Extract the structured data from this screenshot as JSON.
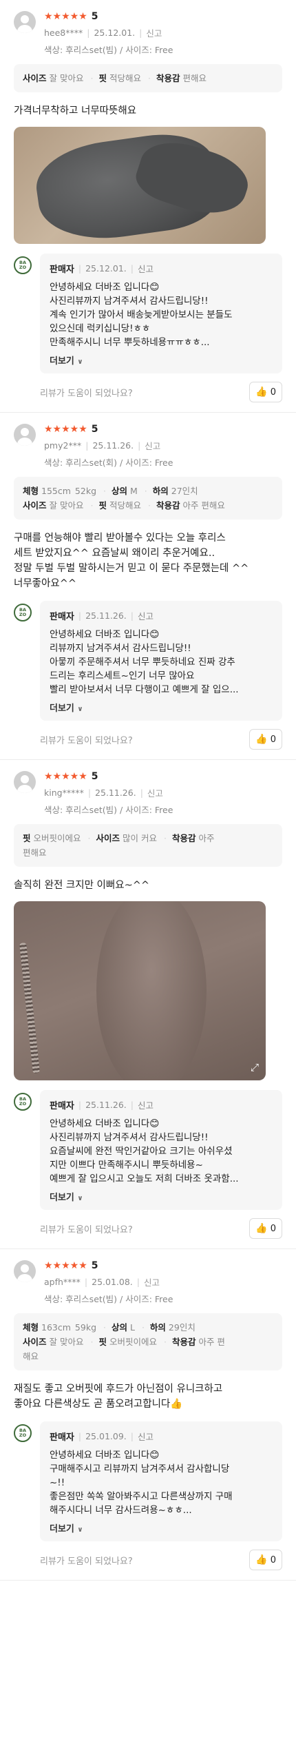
{
  "common": {
    "stars": "★★★★★",
    "report_label": "신고",
    "helpful_question": "리뷰가 도움이 되었나요?",
    "more_label": "더보기",
    "seller_name": "판매자",
    "logo_text": "BA ZO",
    "colors": {
      "star": "#f25a2f",
      "like": "#e0312b",
      "seller_logo": "#3f6b3a"
    }
  },
  "reviews": [
    {
      "score": "5",
      "user": "hee8****",
      "date": "25.12.01.",
      "option": "색상: 후리스set(빔) / 사이즈: Free",
      "fit_line1": [
        {
          "k": "사이즈",
          "v": "잘 맞아요"
        },
        {
          "k": "핏",
          "v": "적당해요"
        },
        {
          "k": "착용감",
          "v": "편해요"
        }
      ],
      "text": "가격너무착하고 너무따뜻해요",
      "seller_date": "25.12.01.",
      "seller_text": "안녕하세요 더바조 입니다😊\n사진리뷰까지 남겨주셔서 감사드립니당!!\n계속 인기가 많아서 배송늦게받아보시는 분들도\n있으신데 럭키십니당!ㅎㅎ\n만족해주시니 너무 뿌듯하네용ㅠㅠㅎㅎ...",
      "likes": "0"
    },
    {
      "score": "5",
      "user": "pmy2***",
      "date": "25.11.26.",
      "option": "색상: 후리스set(회) / 사이즈: Free",
      "body_info": {
        "height_k": "체형",
        "height_v": "155cm",
        "weight_v": "52kg",
        "top_k": "상의",
        "top_v": "M",
        "bottom_k": "하의",
        "bottom_v": "27인치"
      },
      "fit_line1": [
        {
          "k": "사이즈",
          "v": "잘 맞아요"
        },
        {
          "k": "핏",
          "v": "적당해요"
        },
        {
          "k": "착용감",
          "v": "아주 편해요"
        }
      ],
      "text": "구매를 언능해야 빨리 받아볼수 있다는 오늘 후리스\n세트 받았지요^^ 요즘날씨 왜이리 추운거예요..\n정말 두벌 두벌 말하시는거 믿고 이 묻다 주문했는데 ^^\n너무좋아요^^",
      "seller_date": "25.11.26.",
      "seller_text": "안녕하세요 더바조 입니다😊\n리뷰까지 남겨주셔서 감사드립니당!!\n아뭏끼 주문해주셔서 너무 뿌듯하네요 진짜 강추\n드리는 후리스세트~인기 너무 많아요\n빨리 받아보셔서 너무 다행이고 예쁘게 잘 입으...",
      "likes": "0"
    },
    {
      "score": "5",
      "user": "king*****",
      "date": "25.11.26.",
      "option": "색상: 후리스set(빔) / 사이즈: Free",
      "fit_line1": [
        {
          "k": "핏",
          "v": "오버핏이에요"
        },
        {
          "k": "사이즈",
          "v": "많이 커요"
        },
        {
          "k": "착용감",
          "v": "아주"
        }
      ],
      "fit_line2": "편해요",
      "text": "솔직히 완전 크지만  이뻐요~^^",
      "seller_date": "25.11.26.",
      "seller_text": "안녕하세요 더바조 입니다😊\n사진리뷰까지 남겨주셔서 감사드립니당!!\n요즘날씨에 완전 딱인거같아요 크기는 아쉬우셨\n지만 이쁘다 만족해주시니 뿌듯하네용~\n예쁘게 잘 입으시고 오늘도 저희 더바조 옷과함...",
      "likes": "0"
    },
    {
      "score": "5",
      "user": "apfh****",
      "date": "25.01.08.",
      "option": "색상: 후리스set(빔) / 사이즈: Free",
      "body_info": {
        "height_k": "체형",
        "height_v": "163cm",
        "weight_v": "59kg",
        "top_k": "상의",
        "top_v": "L",
        "bottom_k": "하의",
        "bottom_v": "29인치"
      },
      "fit_line1": [
        {
          "k": "사이즈",
          "v": "잘 맞아요"
        },
        {
          "k": "핏",
          "v": "오버핏이에요"
        },
        {
          "k": "착용감",
          "v": "아주 편"
        }
      ],
      "fit_line2": "해요",
      "text": "재질도 좋고 오버핏에 후드가 아닌점이 유니크하고\n좋아요 다른색상도 곧 품오려고합니다👍",
      "seller_date": "25.01.09.",
      "seller_text": "안녕하세요 더바조 입니다😊\n구매해주시고 리뷰까지 남겨주셔서 감사합니당\n~!!\n좋은점만 쏙쏙 알아봐주시고 다른색상까지 구매\n해주시다니 너무 감사드려용~ㅎㅎ...",
      "likes": "0"
    }
  ]
}
